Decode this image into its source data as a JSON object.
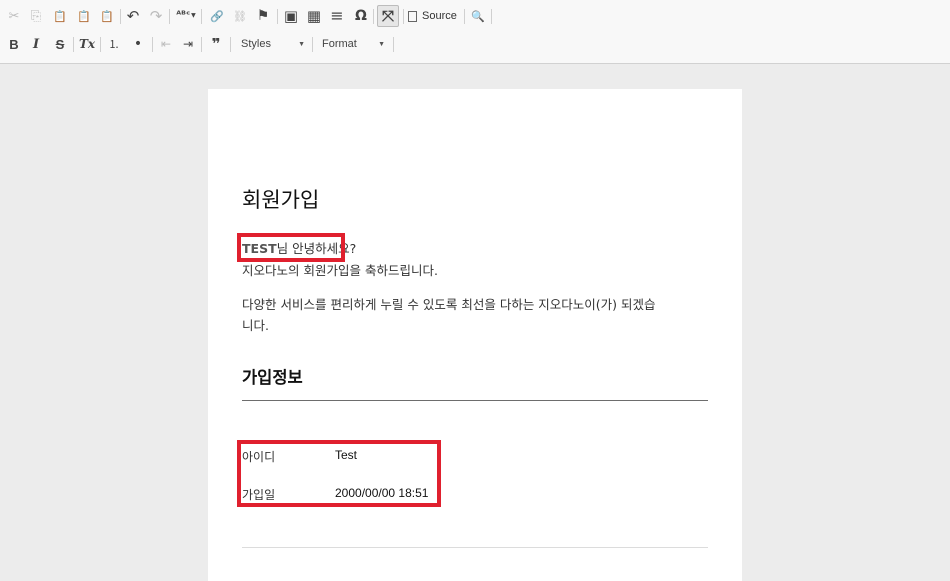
{
  "toolbar": {
    "row1": [
      {
        "name": "cut-icon",
        "glyph": "✂",
        "disabled": true
      },
      {
        "name": "copy-icon",
        "glyph": "⎘",
        "disabled": true
      },
      {
        "name": "paste-icon",
        "glyph": "📋",
        "disabled": false
      },
      {
        "name": "paste-text-icon",
        "glyph": "📋",
        "disabled": false
      },
      {
        "name": "paste-word-icon",
        "glyph": "📋",
        "disabled": false
      },
      {
        "name": "undo-icon",
        "glyph": "↶",
        "disabled": false
      },
      {
        "name": "redo-icon",
        "glyph": "↷",
        "disabled": true
      },
      {
        "name": "spellcheck-icon",
        "glyph": "ᴬᴮᶜ",
        "disabled": false
      },
      {
        "name": "link-icon",
        "glyph": "🔗",
        "disabled": false
      },
      {
        "name": "unlink-icon",
        "glyph": "⛓",
        "disabled": true
      },
      {
        "name": "anchor-flag-icon",
        "glyph": "⚑",
        "disabled": false
      },
      {
        "name": "image-icon",
        "glyph": "▣",
        "disabled": false
      },
      {
        "name": "table-icon",
        "glyph": "▦",
        "disabled": false
      },
      {
        "name": "horizontal-rule-icon",
        "glyph": "≡",
        "disabled": false
      },
      {
        "name": "special-char-icon",
        "glyph": "Ω",
        "disabled": false
      },
      {
        "name": "maximize-icon",
        "glyph": "⤧",
        "disabled": false
      },
      {
        "name": "preview-icon",
        "glyph": "🔍",
        "disabled": false
      }
    ],
    "source_label": "Source",
    "row2": [
      {
        "name": "bold-icon",
        "glyph": "B"
      },
      {
        "name": "italic-icon",
        "glyph": "I"
      },
      {
        "name": "strike-icon",
        "glyph": "S"
      },
      {
        "name": "remove-format-icon",
        "glyph": "Tx"
      },
      {
        "name": "numbered-list-icon",
        "glyph": "⒈"
      },
      {
        "name": "bulleted-list-icon",
        "glyph": "•"
      },
      {
        "name": "outdent-icon",
        "glyph": "⇤"
      },
      {
        "name": "indent-icon",
        "glyph": "⇥"
      },
      {
        "name": "blockquote-icon",
        "glyph": "❞"
      }
    ],
    "styles_label": "Styles",
    "format_label": "Format",
    "arrow_glyph": "▼"
  },
  "document": {
    "title": "회원가입",
    "greeting_name": "TEST",
    "greeting_rest": "님 안녕하세요?",
    "congrats": "지오다노의 회원가입을 축하드립니다.",
    "service_line1": "다양한 서비스를 편리하게 누릴 수 있도록 최선을 다하는 지오다노이(가) 되겠습",
    "service_line2": "니다.",
    "section_title": "가입정보",
    "fields": [
      {
        "label": "아이디",
        "value": "Test"
      },
      {
        "label": "가입일",
        "value": "2000/00/00 18:51"
      }
    ]
  },
  "colors": {
    "highlight": "#e0202e",
    "page": "#ffffff",
    "background": "#ececec"
  }
}
